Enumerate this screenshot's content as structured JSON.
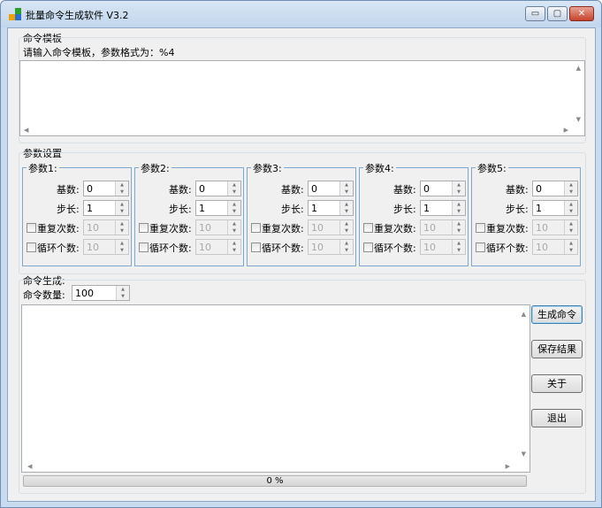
{
  "window": {
    "title": "批量命令生成软件 V3.2",
    "minimize": "▭",
    "maximize": "▢",
    "close": "✕"
  },
  "template": {
    "group_label": "命令模板",
    "hint": "请输入命令模板，参数格式为：%4",
    "value": ""
  },
  "params": {
    "group_label": "参数设置",
    "items": [
      {
        "title": "参数1:",
        "base_label": "基数:",
        "base": "0",
        "step_label": "步长:",
        "step": "1",
        "repeat_label": "重复次数:",
        "repeat": "10",
        "cycle_label": "循环个数:",
        "cycle": "10"
      },
      {
        "title": "参数2:",
        "base_label": "基数:",
        "base": "0",
        "step_label": "步长:",
        "step": "1",
        "repeat_label": "重复次数:",
        "repeat": "10",
        "cycle_label": "循环个数:",
        "cycle": "10"
      },
      {
        "title": "参数3:",
        "base_label": "基数:",
        "base": "0",
        "step_label": "步长:",
        "step": "1",
        "repeat_label": "重复次数:",
        "repeat": "10",
        "cycle_label": "循环个数:",
        "cycle": "10"
      },
      {
        "title": "参数4:",
        "base_label": "基数:",
        "base": "0",
        "step_label": "步长:",
        "step": "1",
        "repeat_label": "重复次数:",
        "repeat": "10",
        "cycle_label": "循环个数:",
        "cycle": "10"
      },
      {
        "title": "参数5:",
        "base_label": "基数:",
        "base": "0",
        "step_label": "步长:",
        "step": "1",
        "repeat_label": "重复次数:",
        "repeat": "10",
        "cycle_label": "循环个数:",
        "cycle": "10"
      }
    ]
  },
  "generate": {
    "group_label": "命令生成:",
    "count_label": "命令数量:",
    "count": "100",
    "output": "",
    "progress_text": "0 %",
    "progress_value": 0
  },
  "buttons": {
    "generate": "生成命令",
    "save": "保存结果",
    "about": "关于",
    "exit": "退出"
  },
  "colors": {
    "accent": "#3c7fb1",
    "progress": "#06b025"
  }
}
